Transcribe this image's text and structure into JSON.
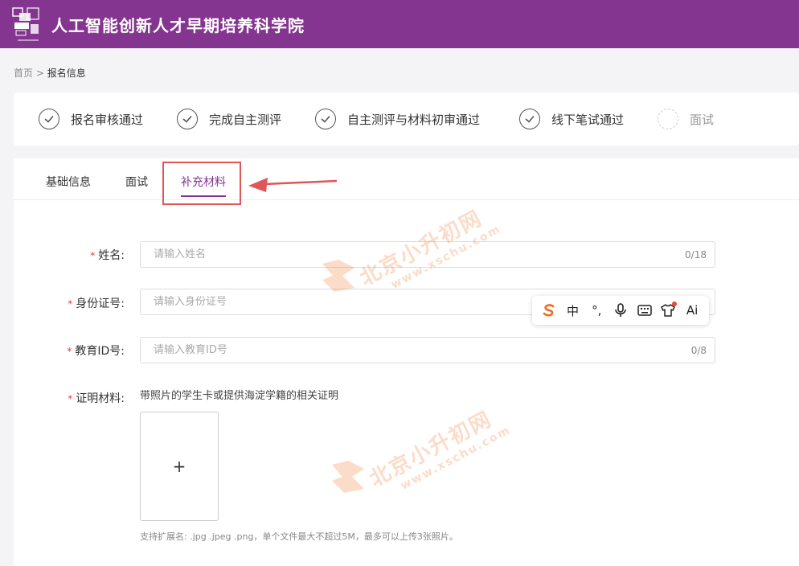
{
  "header": {
    "title": "人工智能创新人才早期培养科学院"
  },
  "breadcrumb": {
    "home": "首页",
    "sep": ">",
    "current": "报名信息"
  },
  "steps": [
    {
      "label": "报名审核通过",
      "status": "done"
    },
    {
      "label": "完成自主测评",
      "status": "done"
    },
    {
      "label": "自主测评与材料初审通过",
      "status": "done"
    },
    {
      "label": "线下笔试通过",
      "status": "done"
    },
    {
      "label": "面试",
      "status": "pending"
    }
  ],
  "tabs": [
    {
      "label": "基础信息",
      "active": false
    },
    {
      "label": "面试",
      "active": false
    },
    {
      "label": "补充材料",
      "active": true
    }
  ],
  "form": {
    "required_mark": "*",
    "name": {
      "label": "姓名:",
      "placeholder": "请输入姓名",
      "value": "",
      "count": "0/18"
    },
    "id_card": {
      "label": "身份证号:",
      "placeholder": "请输入身份证号",
      "value": ""
    },
    "edu_id": {
      "label": "教育ID号:",
      "placeholder": "请输入教育ID号",
      "value": "",
      "count": "0/8"
    },
    "proof": {
      "label": "证明材料:",
      "hint": "带照片的学生卡或提供海淀学籍的相关证明",
      "upload_symbol": "+"
    },
    "upload_note": "支持扩展名: .jpg .jpeg .png，单个文件最大不超过5M，最多可以上传3张照片。"
  },
  "ime_toolbar": {
    "items": [
      {
        "name": "sogou-logo-icon",
        "glyph": "S"
      },
      {
        "name": "chinese-mode",
        "glyph": "中"
      },
      {
        "name": "punctuation-icon",
        "glyph": "°,"
      },
      {
        "name": "microphone-icon",
        "glyph": ""
      },
      {
        "name": "keyboard-icon",
        "glyph": ""
      },
      {
        "name": "skin-icon",
        "glyph": ""
      },
      {
        "name": "ai-icon",
        "glyph": "Ai"
      }
    ]
  },
  "watermark": {
    "text": "北京小升初网",
    "url": "www.xschu.com",
    "color": "#f0823c"
  },
  "colors": {
    "brand": "#84358f",
    "highlight": "#e05656",
    "required": "#e0403a"
  }
}
